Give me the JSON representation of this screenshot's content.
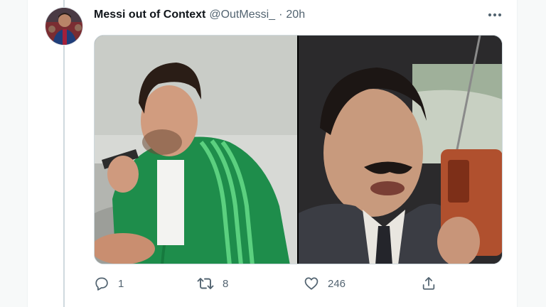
{
  "tweet": {
    "display_name": "Messi out of Context",
    "handle": "@OutMessi_",
    "separator": "·",
    "time": "20h"
  },
  "icons": {
    "more": "more-horizontal-icon",
    "reply": "reply-icon",
    "retweet": "retweet-icon",
    "like": "heart-icon",
    "share": "share-icon"
  },
  "actions": {
    "reply_count": "1",
    "retweet_count": "8",
    "like_count": "246"
  },
  "colors": {
    "text_primary": "#0f1419",
    "text_secondary": "#536471",
    "jacket_green": "#1f8f4e"
  }
}
